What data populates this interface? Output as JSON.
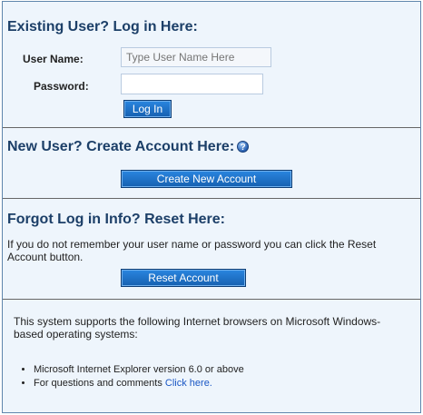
{
  "login": {
    "heading": "Existing User? Log in Here:",
    "username_label": "User Name:",
    "username_placeholder": "Type User Name Here",
    "username_value": "",
    "password_label": "Password:",
    "password_value": "",
    "login_button": "Log In"
  },
  "create": {
    "heading": "New User? Create Account Here:",
    "help_icon_glyph": "?",
    "button": "Create New Account"
  },
  "reset": {
    "heading": "Forgot Log in Info? Reset Here:",
    "description": "If you do not remember your user name or password you can click the Reset Account button.",
    "button": "Reset Account"
  },
  "browsers": {
    "intro": "This system supports the following Internet browsers on Microsoft Windows-based operating systems:",
    "items": [
      "Microsoft Internet Explorer version 6.0 or above",
      "For questions and comments "
    ],
    "link_text": "Click here."
  },
  "colors": {
    "heading": "#1c3f68",
    "panel_bg": "#eef5fc",
    "button": "#1f73c6",
    "link": "#1a57c4"
  }
}
